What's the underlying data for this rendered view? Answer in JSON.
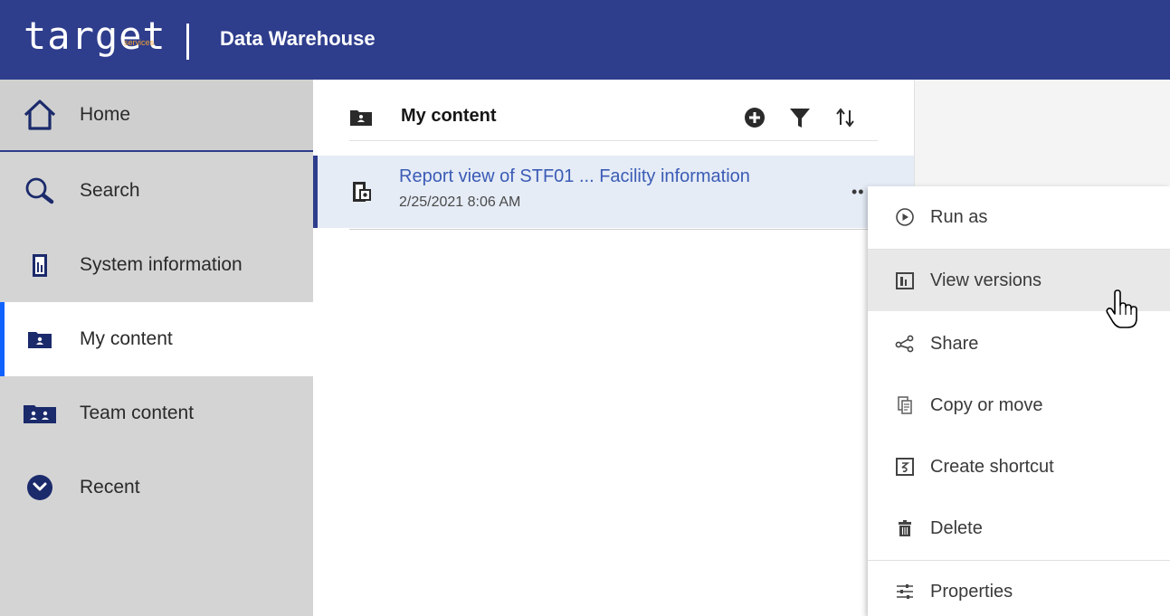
{
  "header": {
    "logo_text": "target",
    "logo_sub": "services",
    "app_title": "Data Warehouse"
  },
  "sidebar": {
    "items": [
      {
        "label": "Home",
        "icon": "home-icon"
      },
      {
        "label": "Search",
        "icon": "search-icon"
      },
      {
        "label": "System information",
        "icon": "report-icon"
      },
      {
        "label": "My content",
        "icon": "my-folder-icon",
        "selected": true
      },
      {
        "label": "Team content",
        "icon": "team-folder-icon"
      },
      {
        "label": "Recent",
        "icon": "clock-icon"
      }
    ]
  },
  "main": {
    "title": "My content",
    "tools": [
      "add-icon",
      "filter-icon",
      "sort-icon"
    ],
    "items": [
      {
        "title": "Report view of STF01 ... Facility information",
        "date": "2/25/2021 8:06 AM",
        "more": "••"
      }
    ]
  },
  "context_menu": {
    "items": [
      {
        "label": "Run as",
        "icon": "play-circle-icon"
      },
      {
        "label": "View versions",
        "icon": "versions-icon",
        "hover": true
      },
      {
        "label": "Share",
        "icon": "share-icon"
      },
      {
        "label": "Copy or move",
        "icon": "copy-icon"
      },
      {
        "label": "Create shortcut",
        "icon": "shortcut-icon"
      },
      {
        "label": "Delete",
        "icon": "trash-icon"
      },
      {
        "label": "Properties",
        "icon": "sliders-icon"
      }
    ]
  },
  "colors": {
    "header_bg": "#2e3d8c",
    "accent": "#0f62fe",
    "link": "#3b5bb5",
    "logo_accent": "#f0a030"
  }
}
